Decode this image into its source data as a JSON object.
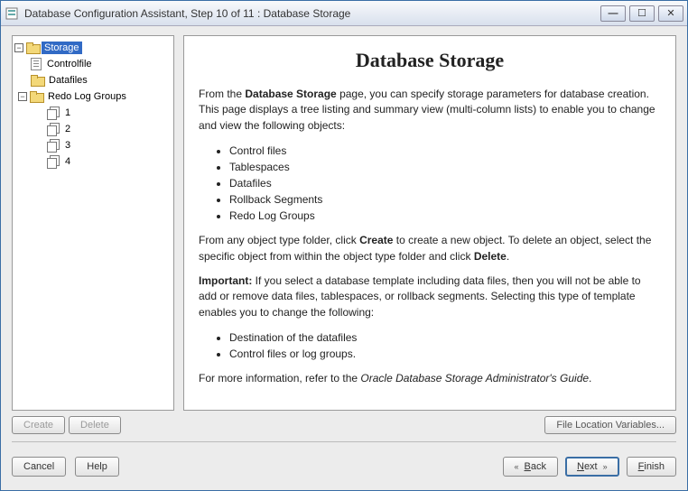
{
  "window": {
    "title": "Database Configuration Assistant, Step 10 of 11 : Database Storage"
  },
  "tree": {
    "root": {
      "label": "Storage"
    },
    "items": [
      {
        "label": "Controlfile"
      },
      {
        "label": "Datafiles"
      },
      {
        "label": "Redo Log Groups"
      }
    ],
    "redo": [
      "1",
      "2",
      "3",
      "4"
    ]
  },
  "buttons": {
    "create": "Create",
    "delete": "Delete",
    "file_loc": "File Location Variables...",
    "cancel": "Cancel",
    "help": "Help",
    "back": "Back",
    "next": "Next",
    "finish": "Finish"
  },
  "content": {
    "heading": "Database Storage",
    "p1a": "From the ",
    "p1b": "Database Storage",
    "p1c": " page, you can specify storage parameters for database creation. This page displays a tree listing and summary view (multi-column lists) to enable you to change and view the following objects:",
    "list1": [
      "Control files",
      "Tablespaces",
      "Datafiles",
      "Rollback Segments",
      "Redo Log Groups"
    ],
    "p2a": "From any object type folder, click ",
    "p2b": "Create",
    "p2c": " to create a new object. To delete an object, select the specific object from within the object type folder and click ",
    "p2d": "Delete",
    "p2e": ".",
    "p3a": "Important:",
    "p3b": " If you select a database template including data files, then you will not be able to add or remove data files, tablespaces, or rollback segments. Selecting this type of template enables you to change the following:",
    "list2": [
      "Destination of the datafiles",
      "Control files or log groups."
    ],
    "p4a": "For more information, refer to the ",
    "p4b": "Oracle Database Storage Administrator's Guide",
    "p4c": "."
  }
}
